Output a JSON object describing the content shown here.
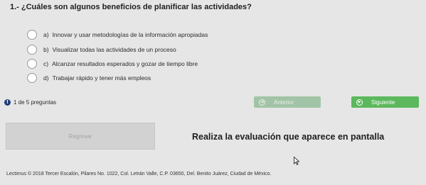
{
  "question": {
    "title": "1.- ¿Cuáles son algunos beneficios de planificar las actividades?",
    "options": [
      {
        "letter": "a)",
        "text": "Innovar y usar metodologías de la información apropiadas"
      },
      {
        "letter": "b)",
        "text": "Visualizar todas las actividades de un proceso"
      },
      {
        "letter": "c)",
        "text": "Alcanzar resultados esperados y gozar de tiempo libre"
      },
      {
        "letter": "d)",
        "text": "Trabajar rápido y tener más empleos"
      }
    ]
  },
  "progress": {
    "text": "1 de 5 preguntas",
    "icon": "info-icon"
  },
  "nav": {
    "previous_label": "Anterior",
    "next_label": "Siguiente"
  },
  "back_button": {
    "label": "Regresar"
  },
  "evaluation_prompt": "Realiza la evaluación que aparece en pantalla",
  "footer": {
    "text": "Lectimus © 2018 Tercer Escalón, Pilares No. 1022, Col. Letrán Valle, C.P. 03650, Del. Benito Juárez, Ciudad de México."
  },
  "colors": {
    "background": "#e6e6e6",
    "next_button": "#5cb85c",
    "previous_button_disabled": "#a2c4a6",
    "info_icon": "#1f3c78"
  }
}
